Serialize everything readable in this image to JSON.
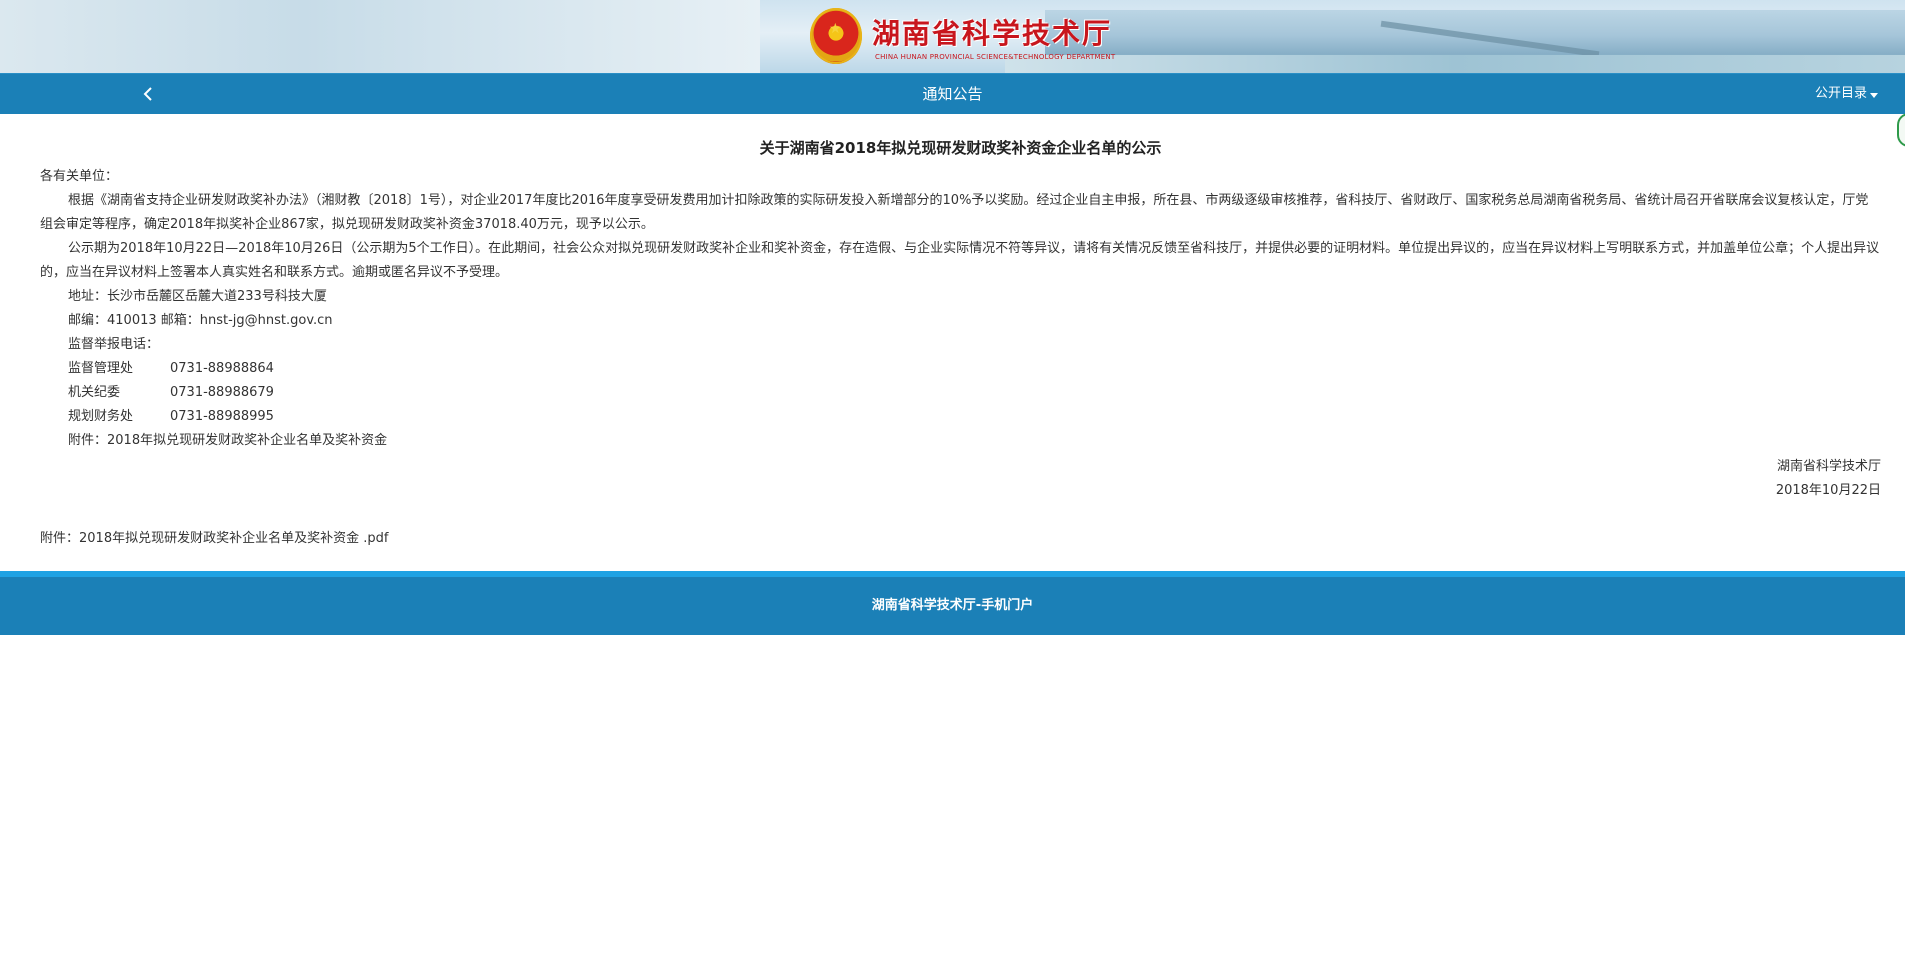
{
  "header": {
    "site_title": "湖南省科学技术厅",
    "site_subtitle": "CHINA HUNAN PROVINCIAL SCIENCE&TECHNOLOGY DEPARTMENT"
  },
  "navbar": {
    "title": "通知公告",
    "catalog_label": "公开目录"
  },
  "article": {
    "title": "关于湖南省2018年拟兑现研发财政奖补资金企业名单的公示",
    "greeting": "各有关单位：",
    "paragraph1": "根据《湖南省支持企业研发财政奖补办法》（湘财教〔2018〕1号），对企业2017年度比2016年度享受研发费用加计扣除政策的实际研发投入新增部分的10%予以奖励。经过企业自主申报，所在县、市两级逐级审核推荐，省科技厅、省财政厅、国家税务总局湖南省税务局、省统计局召开省联席会议复核认定，厅党组会审定等程序，确定2018年拟奖补企业867家，拟兑现研发财政奖补资金37018.40万元，现予以公示。",
    "paragraph2": "公示期为2018年10月22日—2018年10月26日（公示期为5个工作日）。在此期间，社会公众对拟兑现研发财政奖补企业和奖补资金，存在造假、与企业实际情况不符等异议，请将有关情况反馈至省科技厅，并提供必要的证明材料。单位提出异议的，应当在异议材料上写明联系方式，并加盖单位公章；个人提出异议的，应当在异议材料上签署本人真实姓名和联系方式。逾期或匿名异议不予受理。",
    "address": "地址：长沙市岳麓区岳麓大道233号科技大厦",
    "postal": "邮编：410013 邮箱：hnst-jg@hnst.gov.cn",
    "hotline_label": "监督举报电话：",
    "contacts": [
      {
        "dept": "监督管理处",
        "phone": "0731-88988864"
      },
      {
        "dept": "机关纪委",
        "phone": "0731-88988679"
      },
      {
        "dept": "规划财务处",
        "phone": "0731-88988995"
      }
    ],
    "attachment_note": "附件：2018年拟兑现研发财政奖补企业名单及奖补资金",
    "signature_org": "湖南省科学技术厅",
    "signature_date": "2018年10月22日",
    "attachment_link": "附件：2018年拟兑现研发财政奖补企业名单及奖补资金 .pdf"
  },
  "footer": {
    "text": "湖南省科学技术厅-手机门户"
  },
  "colors": {
    "nav_blue": "#1b80b7",
    "title_red": "#c8161d",
    "footer_accent": "#1fa2e3"
  }
}
